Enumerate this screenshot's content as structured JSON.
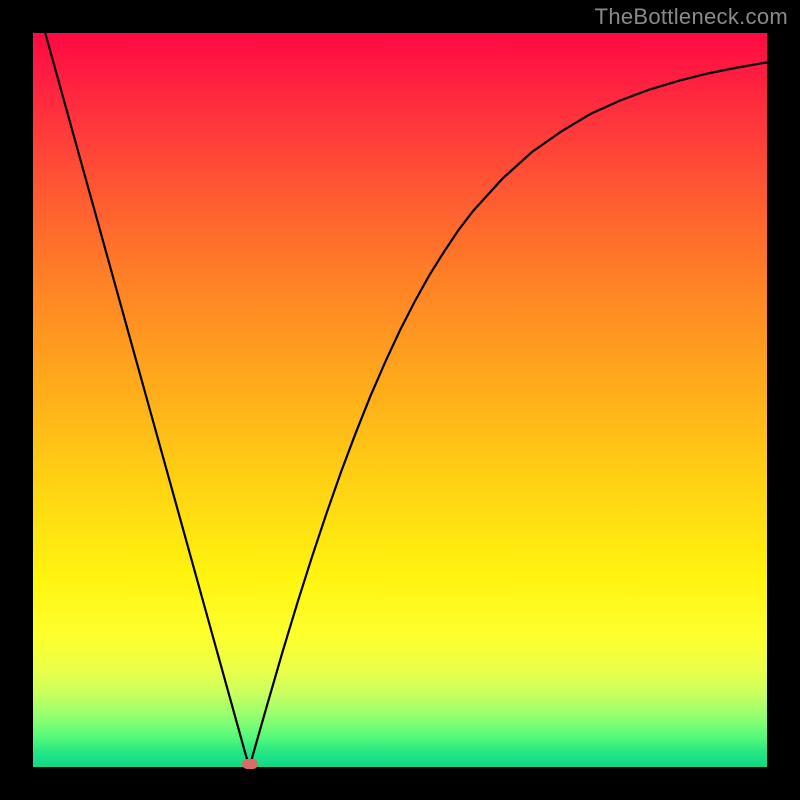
{
  "watermark": "TheBottleneck.com",
  "colors": {
    "frame_bg": "#000000",
    "curve_stroke": "#000000",
    "marker_fill": "#db6b69",
    "watermark_color": "#8a8a8a"
  },
  "chart_data": {
    "type": "line",
    "title": "",
    "xlabel": "",
    "ylabel": "",
    "xlim": [
      0,
      1
    ],
    "ylim": [
      0,
      1
    ],
    "x": [
      0.0,
      0.02,
      0.04,
      0.06,
      0.08,
      0.1,
      0.12,
      0.14,
      0.16,
      0.18,
      0.2,
      0.22,
      0.24,
      0.26,
      0.28,
      0.285,
      0.29,
      0.295,
      0.3,
      0.31,
      0.32,
      0.34,
      0.36,
      0.38,
      0.4,
      0.42,
      0.44,
      0.46,
      0.48,
      0.5,
      0.52,
      0.54,
      0.56,
      0.58,
      0.6,
      0.64,
      0.68,
      0.72,
      0.76,
      0.8,
      0.84,
      0.88,
      0.92,
      0.96,
      1.0
    ],
    "values": [
      1.06,
      0.988,
      0.916,
      0.844,
      0.772,
      0.7,
      0.628,
      0.556,
      0.484,
      0.412,
      0.34,
      0.268,
      0.196,
      0.124,
      0.052,
      0.034,
      0.016,
      0.0,
      0.018,
      0.053,
      0.088,
      0.157,
      0.223,
      0.286,
      0.346,
      0.403,
      0.456,
      0.506,
      0.552,
      0.595,
      0.634,
      0.67,
      0.702,
      0.732,
      0.758,
      0.802,
      0.838,
      0.866,
      0.89,
      0.908,
      0.923,
      0.935,
      0.945,
      0.953,
      0.96
    ],
    "marker": {
      "x": 0.295,
      "y": 0.0
    },
    "grid": false,
    "legend": false
  }
}
